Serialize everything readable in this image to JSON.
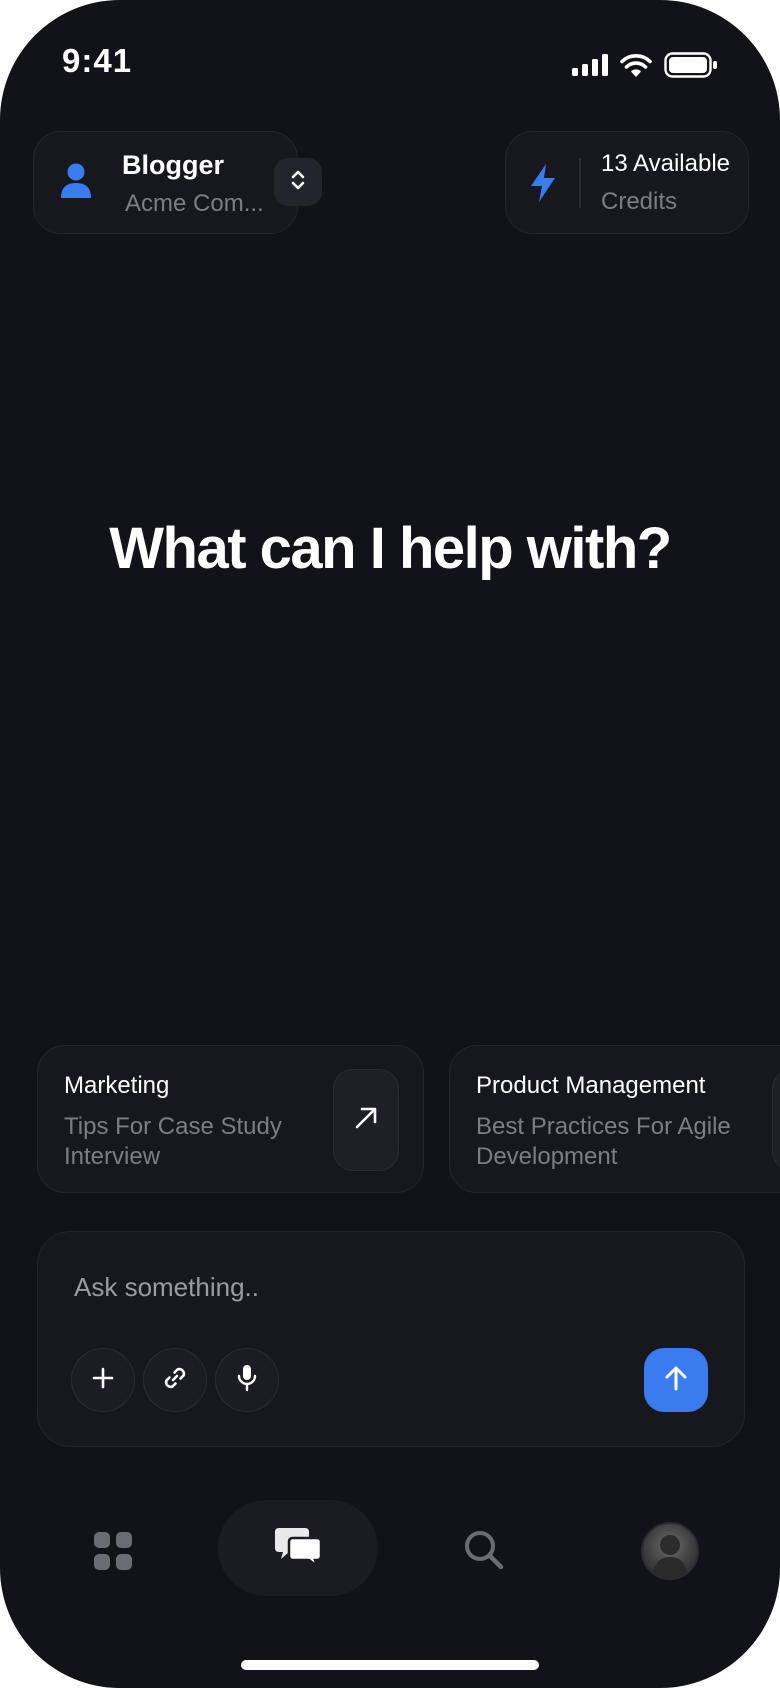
{
  "status_bar": {
    "time": "9:41",
    "icons": [
      "cellular-signal-icon",
      "wifi-icon",
      "battery-icon"
    ]
  },
  "header": {
    "role": {
      "title": "Blogger",
      "subtitle": "Acme Com...",
      "icon": "person-icon",
      "switch_icon": "chevron-up-down-icon"
    },
    "credits": {
      "count_label": "13 Available",
      "label": "Credits",
      "icon": "lightning-icon"
    }
  },
  "main": {
    "heading": "What can I help with?"
  },
  "suggestions": [
    {
      "title": "Marketing",
      "description": "Tips For Case Study Interview",
      "icon": "arrow-up-right-icon"
    },
    {
      "title": "Product Management",
      "description": "Best Practices For Agile Development",
      "icon": "arrow-up-right-icon"
    }
  ],
  "composer": {
    "placeholder": "Ask something..",
    "tools": [
      "plus-icon",
      "link-icon",
      "microphone-icon"
    ],
    "send_icon": "arrow-up-icon"
  },
  "tab_bar": {
    "items": [
      "apps-grid-icon",
      "chat-bubbles-icon",
      "search-icon",
      "profile-avatar"
    ],
    "active": "chat-bubbles-icon"
  },
  "colors": {
    "background": "#121318",
    "surface": "#17181e",
    "accent": "#3a7bf0",
    "muted_text": "#7c7d85"
  }
}
